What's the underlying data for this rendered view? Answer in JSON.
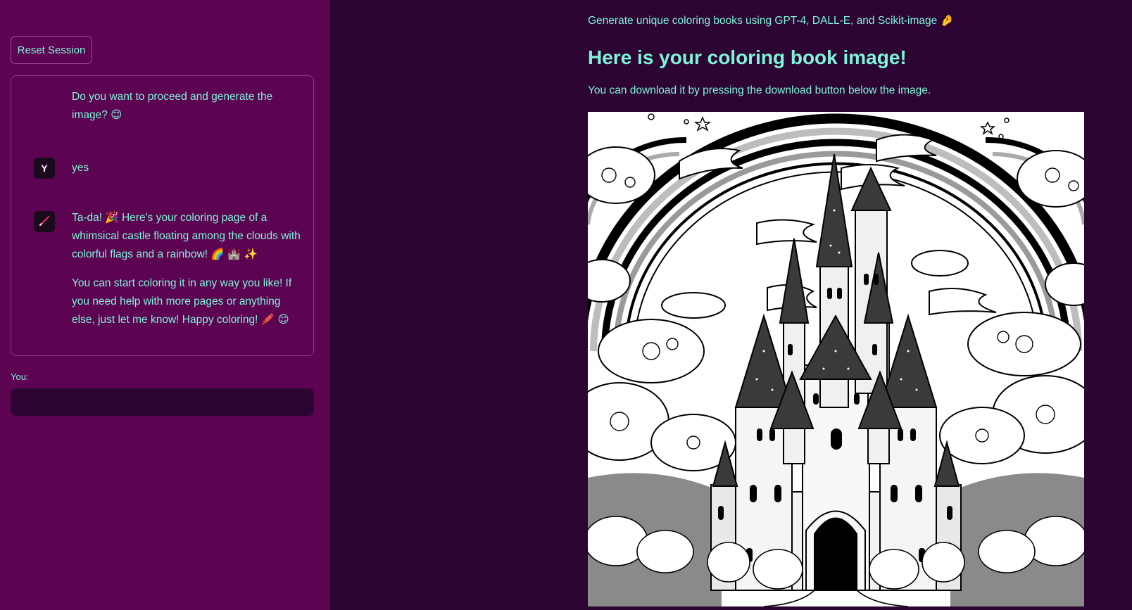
{
  "sidebar": {
    "reset_label": "Reset Session",
    "messages": [
      {
        "role": "assistant",
        "paragraphs": [
          "Do you want to proceed and generate the image? 😊"
        ]
      },
      {
        "role": "user",
        "avatar_letter": "Y",
        "paragraphs": [
          "yes"
        ]
      },
      {
        "role": "assistant",
        "avatar_icon": "pencil-icon",
        "paragraphs": [
          "Ta-da! 🎉 Here's your coloring page of a whimsical castle floating among the clouds with colorful flags and a rainbow! 🌈 🏰 ✨",
          "You can start coloring it in any way you like! If you need help with more pages or anything else, just let me know! Happy coloring! 🖍️ 😊"
        ]
      }
    ],
    "input_label": "You:",
    "input_value": "",
    "input_placeholder": ""
  },
  "main": {
    "subtitle": "Generate unique coloring books using GPT-4, DALL-E, and Scikit-image 🤌",
    "heading": "Here is your coloring book image!",
    "description": "You can download it by pressing the download button below the image.",
    "image_subject": "coloring-page-castle-rainbow"
  },
  "colors": {
    "sidebar_bg": "#5c0452",
    "main_bg": "#2c0533",
    "text": "#7ef5d8",
    "avatar_bg": "#1b0a1c"
  }
}
